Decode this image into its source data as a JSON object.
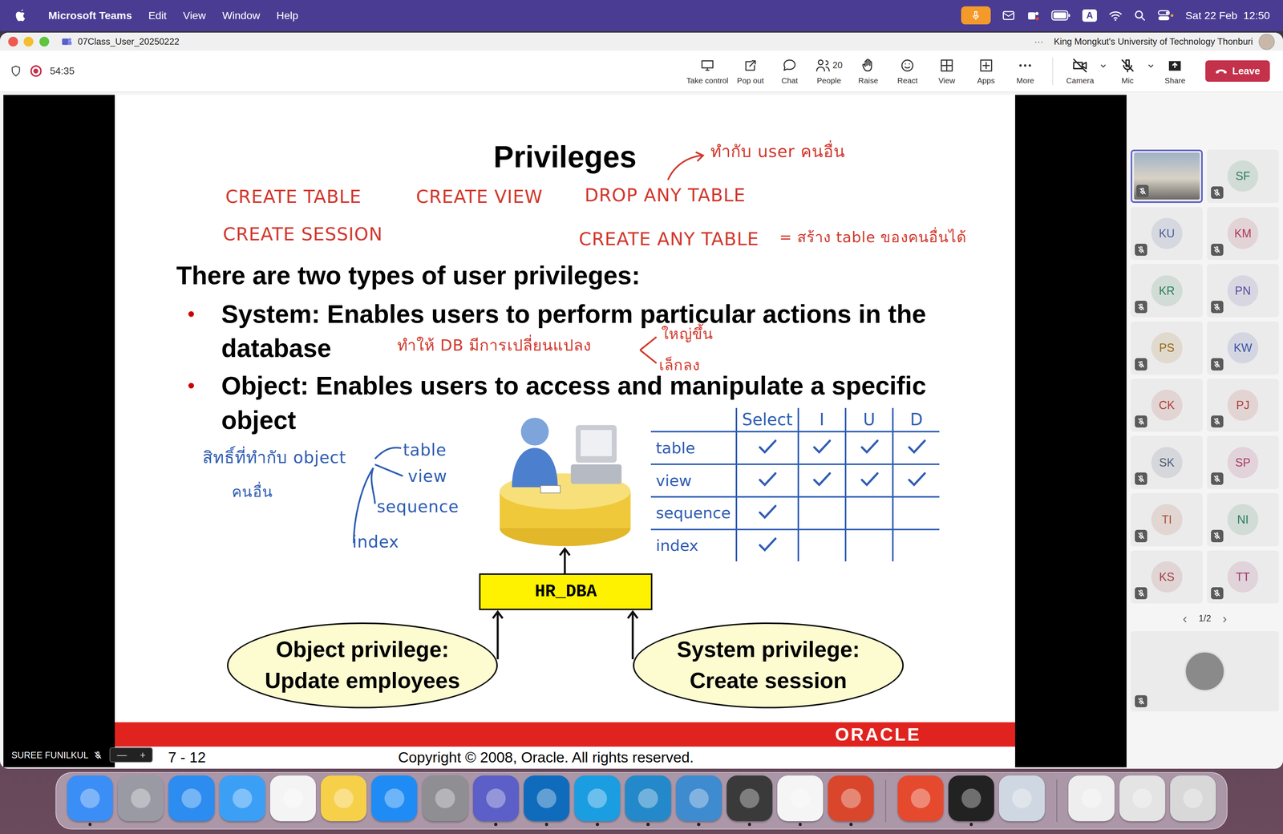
{
  "menubar": {
    "app": "Microsoft Teams",
    "menus": [
      "Edit",
      "View",
      "Window",
      "Help"
    ],
    "input_source": "A",
    "clock": "Sat 22 Feb  12:50",
    "mic_active": true
  },
  "window": {
    "title": "07Class_User_20250222",
    "more": "···",
    "org": "King Mongkut's University of Technology Thonburi"
  },
  "call": {
    "timer": "54:35",
    "recording": true,
    "tools": [
      {
        "label": "Take control",
        "kind": "control",
        "count": ""
      },
      {
        "label": "Pop out",
        "kind": "popout",
        "count": ""
      },
      {
        "label": "Chat",
        "kind": "chat",
        "count": ""
      },
      {
        "label": "People",
        "kind": "people",
        "count": "20"
      },
      {
        "label": "Raise",
        "kind": "raise",
        "count": ""
      },
      {
        "label": "React",
        "kind": "react",
        "count": ""
      },
      {
        "label": "View",
        "kind": "view",
        "count": ""
      },
      {
        "label": "Apps",
        "kind": "apps",
        "count": ""
      },
      {
        "label": "More",
        "kind": "more",
        "count": ""
      }
    ],
    "devices": [
      {
        "label": "Camera",
        "kind": "camera",
        "on": false
      },
      {
        "label": "Mic",
        "kind": "mic",
        "on": false
      }
    ],
    "share": "Share",
    "leave": "Leave"
  },
  "share": {
    "presenter": "SUREE FUNILKUL",
    "presenter_muted": true,
    "zoom": [
      "—",
      "+"
    ]
  },
  "slide": {
    "title": "Privileges",
    "heading": "There are two types of user privileges:",
    "marker": "•",
    "bullets": [
      "System: Enables users to perform particular actions in the database",
      "Object: Enables users to access and manipulate a specific object"
    ],
    "ink": [
      {
        "text": "CREATE TABLE",
        "color": "#d2392e"
      },
      {
        "text": "CREATE VIEW",
        "color": "#d2392e"
      },
      {
        "text": "DROP ANY TABLE",
        "color": "#d2392e"
      },
      {
        "text": "CREATE SESSION",
        "color": "#d2392e"
      },
      {
        "text": "CREATE ANY TABLE",
        "color": "#d2392e"
      },
      {
        "text": "ทำกับ user คนอื่น",
        "color": "#d2392e"
      },
      {
        "text": "= สร้าง table ของคนอื่นได้",
        "color": "#d2392e"
      },
      {
        "text": "ทำให้ DB มีการเปลี่ยนแปลง",
        "color": "#d2392e"
      },
      {
        "text": "ใหญ่ขึ้น",
        "color": "#d2392e"
      },
      {
        "text": "เล็กลง",
        "color": "#d2392e"
      },
      {
        "text": "สิทธิ์ที่ทำกับ object",
        "color": "#2f5db3"
      },
      {
        "text": "คนอื่น",
        "color": "#2f5db3"
      },
      {
        "text": "table",
        "color": "#2f5db3"
      },
      {
        "text": "view",
        "color": "#2f5db3"
      },
      {
        "text": "sequence",
        "color": "#2f5db3"
      },
      {
        "text": "index",
        "color": "#2f5db3"
      }
    ],
    "matrix": {
      "columns": [
        "Select",
        "I",
        "U",
        "D"
      ],
      "rows": [
        {
          "label": "table",
          "checks": [
            true,
            true,
            true,
            true
          ]
        },
        {
          "label": "view",
          "checks": [
            true,
            true,
            true,
            true
          ]
        },
        {
          "label": "sequence",
          "checks": [
            true,
            false,
            false,
            false
          ]
        },
        {
          "label": "index",
          "checks": [
            true,
            false,
            false,
            false
          ]
        }
      ]
    },
    "diagram": {
      "center": "HR_DBA",
      "left": [
        "Object privilege:",
        "Update employees"
      ],
      "right": [
        "System privilege:",
        "Create session"
      ]
    },
    "footer": {
      "brand": "ORACLE",
      "page": "7 - 12",
      "copyright": "Copyright © 2008, Oracle. All rights reserved."
    }
  },
  "participants": [
    {
      "initials": "",
      "kind": "video",
      "selected": true,
      "muted": true,
      "color": "#6a7a8a"
    },
    {
      "initials": "SF",
      "kind": "initials",
      "selected": false,
      "muted": true,
      "color": "#2e7d5b"
    },
    {
      "initials": "KU",
      "kind": "initials",
      "selected": false,
      "muted": true,
      "color": "#4f5f9a"
    },
    {
      "initials": "KM",
      "kind": "initials",
      "selected": false,
      "muted": true,
      "color": "#b03a5b"
    },
    {
      "initials": "KR",
      "kind": "initials",
      "selected": false,
      "muted": true,
      "color": "#2e7d5b"
    },
    {
      "initials": "PN",
      "kind": "initials",
      "selected": false,
      "muted": true,
      "color": "#5e4fa2"
    },
    {
      "initials": "PS",
      "kind": "initials",
      "selected": false,
      "muted": true,
      "color": "#9a6a12"
    },
    {
      "initials": "KW",
      "kind": "initials",
      "selected": false,
      "muted": true,
      "color": "#3c55a8"
    },
    {
      "initials": "CK",
      "kind": "initials",
      "selected": false,
      "muted": true,
      "color": "#b0403a"
    },
    {
      "initials": "PJ",
      "kind": "initials",
      "selected": false,
      "muted": true,
      "color": "#b0403a"
    },
    {
      "initials": "SK",
      "kind": "initials",
      "selected": false,
      "muted": true,
      "color": "#4f5a78"
    },
    {
      "initials": "SP",
      "kind": "initials",
      "selected": false,
      "muted": true,
      "color": "#a83a68"
    },
    {
      "initials": "TI",
      "kind": "initials",
      "selected": false,
      "muted": true,
      "color": "#b0503a"
    },
    {
      "initials": "NI",
      "kind": "initials",
      "selected": false,
      "muted": true,
      "color": "#2e7d5b"
    },
    {
      "initials": "KS",
      "kind": "initials",
      "selected": false,
      "muted": true,
      "color": "#a04040"
    },
    {
      "initials": "TT",
      "kind": "initials",
      "selected": false,
      "muted": true,
      "color": "#a03a6a"
    },
    {
      "initials": "",
      "kind": "avatar",
      "selected": false,
      "muted": true,
      "color": "#8a8a8a"
    }
  ],
  "pager": {
    "prev": "‹",
    "label": "1/2",
    "next": "›"
  },
  "dock": [
    [
      {
        "color": "#3b8ef5",
        "running": true
      },
      {
        "color": "#9a9aa5",
        "running": false
      },
      {
        "color": "#2c8cf0",
        "running": false
      },
      {
        "color": "#3ba0f5",
        "running": false
      },
      {
        "color": "#f4f4f4",
        "running": false
      },
      {
        "color": "#f7d04a",
        "running": false
      },
      {
        "color": "#1f8cf5",
        "running": false
      },
      {
        "color": "#8e8e93",
        "running": false
      },
      {
        "color": "#5b5fc7",
        "running": true
      },
      {
        "color": "#0f6cbd",
        "running": true
      },
      {
        "color": "#1b9de2",
        "running": true
      },
      {
        "color": "#2489ca",
        "running": true
      },
      {
        "color": "#3f8bd0",
        "running": true
      },
      {
        "color": "#3a3a3a",
        "running": true
      },
      {
        "color": "#f5f5f5",
        "running": true
      },
      {
        "color": "#d9462c",
        "running": true
      }
    ],
    [
      {
        "color": "#e64a2e",
        "running": false
      },
      {
        "color": "#222222",
        "running": true
      },
      {
        "color": "#cfd8e2",
        "running": false
      }
    ],
    [
      {
        "color": "#eeeeee",
        "running": false
      },
      {
        "color": "#e4e4e4",
        "running": false
      },
      {
        "color": "#d8d8d8",
        "running": false
      }
    ]
  ]
}
